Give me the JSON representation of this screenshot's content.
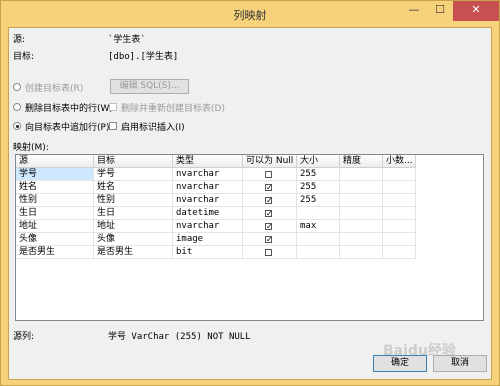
{
  "window": {
    "title": "列映射",
    "min": "—",
    "max": "☐",
    "close": "✕"
  },
  "source": {
    "label": "源:",
    "value": "`学生表`"
  },
  "target": {
    "label": "目标:",
    "value": "[dbo].[学生表]"
  },
  "options": {
    "create": "创建目标表(R)",
    "edit_sql": "编辑 SQL(S)...",
    "delete_rows": "删除目标表中的行(W)",
    "drop_recreate": "删除并重新创建目标表(D)",
    "append": "向目标表中追加行(P)",
    "identity": "启用标识插入(I)"
  },
  "mappings_label": "映射(M):",
  "columns": [
    "源",
    "目标",
    "类型",
    "可以为 Null",
    "大小",
    "精度",
    "小数..."
  ],
  "rows": [
    {
      "src": "学号",
      "dst": "学号",
      "type": "nvarchar",
      "nullable": false,
      "size": "255",
      "selected": true
    },
    {
      "src": "姓名",
      "dst": "姓名",
      "type": "nvarchar",
      "nullable": true,
      "size": "255"
    },
    {
      "src": "性别",
      "dst": "性别",
      "type": "nvarchar",
      "nullable": true,
      "size": "255"
    },
    {
      "src": "生日",
      "dst": "生日",
      "type": "datetime",
      "nullable": true,
      "size": ""
    },
    {
      "src": "地址",
      "dst": "地址",
      "type": "nvarchar",
      "nullable": true,
      "size": "max"
    },
    {
      "src": "头像",
      "dst": "头像",
      "type": "image",
      "nullable": true,
      "size": ""
    },
    {
      "src": "是否男生",
      "dst": "是否男生",
      "type": "bit",
      "nullable": false,
      "size": ""
    }
  ],
  "source_column": {
    "label": "源列:",
    "value": "学号 VarChar (255) NOT NULL"
  },
  "buttons": {
    "ok": "确定",
    "cancel": "取消"
  },
  "watermark": "Baidu经验"
}
